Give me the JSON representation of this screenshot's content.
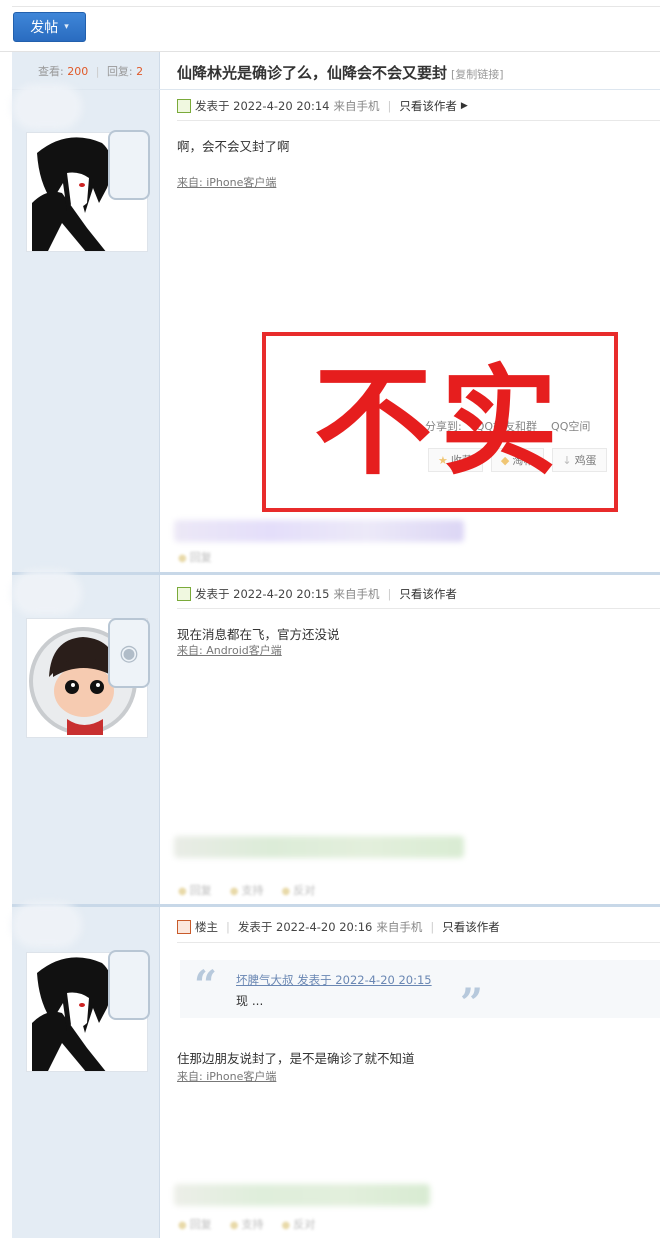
{
  "toolbar": {
    "post_label": "发帖",
    "post_caret": "▾"
  },
  "thread": {
    "views_label": "查看:",
    "views": "200",
    "replies_label": "回复:",
    "replies": "2",
    "title": "仙降林光是确诊了么，仙降会不会又要封",
    "copy_link": "[复制链接]"
  },
  "posts": [
    {
      "author_tag": "",
      "posted": "发表于 2022-4-20 20:14",
      "mobile": "来自手机",
      "only_author": "只看该作者",
      "content": "啊，会不会又封了啊",
      "source": "来自: iPhone客户端",
      "device": "iphone",
      "action1": "回复"
    },
    {
      "author_tag": "",
      "posted": "发表于 2022-4-20 20:15",
      "mobile": "来自手机",
      "only_author": "只看该作者",
      "content": "现在消息都在飞，官方还没说",
      "source": "来自: Android客户端",
      "device": "android",
      "action1": "回复",
      "action2": "支持",
      "action3": "反对"
    },
    {
      "author_tag": "楼主",
      "posted": "发表于 2022-4-20 20:16",
      "mobile": "来自手机",
      "only_author": "只看该作者",
      "quote_head": "坏脾气大叔 发表于 2022-4-20 20:15",
      "quote_text": "现 ...",
      "content": "住那边朋友说封了，是不是确诊了就不知道",
      "source": "来自: iPhone客户端",
      "device": "iphone",
      "action1": "回复",
      "action2": "支持",
      "action3": "反对"
    }
  ],
  "share": {
    "label": "分享到:",
    "qq_group": "QQ好友和群",
    "qzone": "QQ空间",
    "favorite": "收藏",
    "recommend": "淘帖",
    "egg": "鸡蛋"
  },
  "stamp": {
    "text": "不实",
    "color": "#e61e1e"
  },
  "colors": {
    "accent": "#2a6cc0",
    "sidebar": "#e4ecf4",
    "stat_number": "#e05a2a",
    "quote_link": "#6a87b3"
  }
}
